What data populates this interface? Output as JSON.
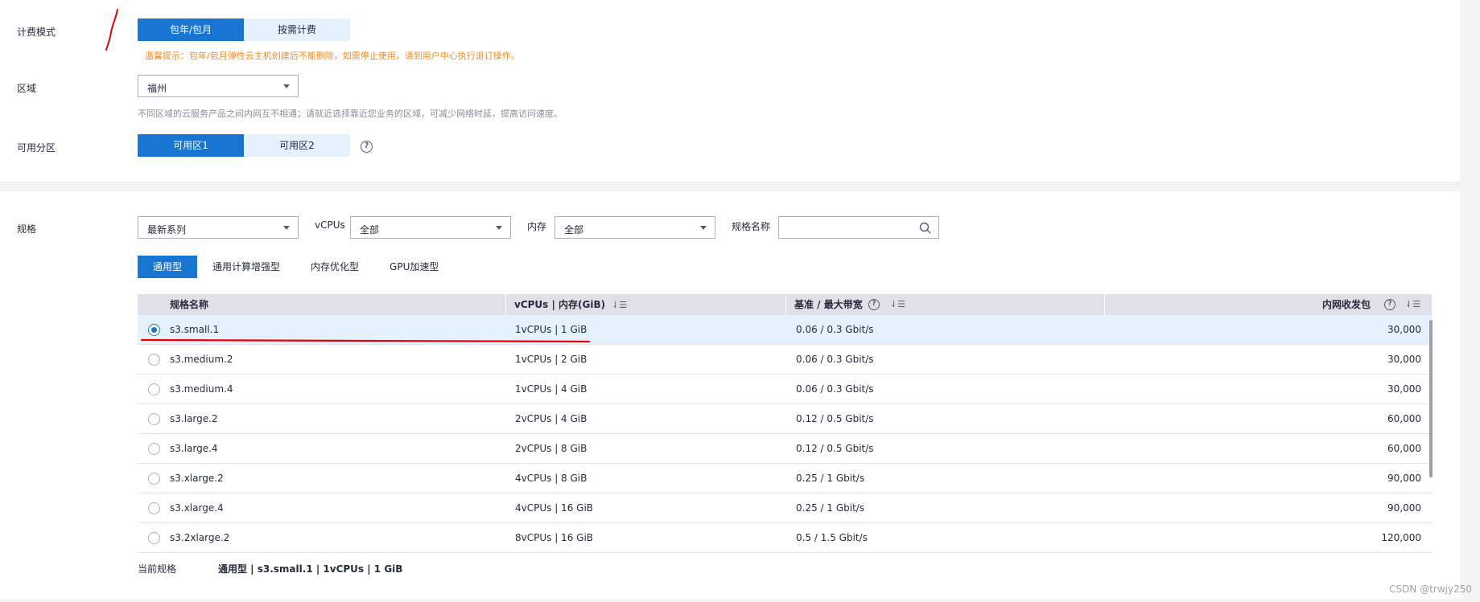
{
  "billing": {
    "label": "计费模式",
    "options": [
      "包年/包月",
      "按需计费"
    ],
    "selected_index": 0,
    "warning": "温馨提示：包年/包月弹性云主机创建后不能删除，如需停止使用，请到用户中心执行退订操作。"
  },
  "region": {
    "label": "区域",
    "value": "福州",
    "hint": "不同区域的云服务产品之间内网互不相通；请就近选择靠近您业务的区域，可减少网络时延，提高访问速度。"
  },
  "az": {
    "label": "可用分区",
    "options": [
      "可用区1",
      "可用区2"
    ],
    "selected_index": 0,
    "help": "?"
  },
  "spec": {
    "label": "规格",
    "filters": {
      "series_value": "最新系列",
      "vcpus_label": "vCPUs",
      "vcpus_value": "全部",
      "memory_label": "内存",
      "memory_value": "全部",
      "name_label": "规格名称",
      "name_value": ""
    },
    "tabs": [
      "通用型",
      "通用计算增强型",
      "内存优化型",
      "GPU加速型"
    ],
    "active_tab": 0,
    "columns": {
      "name": "规格名称",
      "vcpus_mem": "vCPUs | 内存(GiB)",
      "bandwidth": "基准 / 最大带宽",
      "pps": "内网收发包"
    },
    "rows": [
      {
        "name": "s3.small.1",
        "cpu_mem": "1vCPUs | 1 GiB",
        "bw": "0.06 / 0.3 Gbit/s",
        "pps": "30,000",
        "selected": true
      },
      {
        "name": "s3.medium.2",
        "cpu_mem": "1vCPUs | 2 GiB",
        "bw": "0.06 / 0.3 Gbit/s",
        "pps": "30,000",
        "selected": false
      },
      {
        "name": "s3.medium.4",
        "cpu_mem": "1vCPUs | 4 GiB",
        "bw": "0.06 / 0.3 Gbit/s",
        "pps": "30,000",
        "selected": false
      },
      {
        "name": "s3.large.2",
        "cpu_mem": "2vCPUs | 4 GiB",
        "bw": "0.12 / 0.5 Gbit/s",
        "pps": "60,000",
        "selected": false
      },
      {
        "name": "s3.large.4",
        "cpu_mem": "2vCPUs | 8 GiB",
        "bw": "0.12 / 0.5 Gbit/s",
        "pps": "60,000",
        "selected": false
      },
      {
        "name": "s3.xlarge.2",
        "cpu_mem": "4vCPUs | 8 GiB",
        "bw": "0.25 / 1 Gbit/s",
        "pps": "90,000",
        "selected": false
      },
      {
        "name": "s3.xlarge.4",
        "cpu_mem": "4vCPUs | 16 GiB",
        "bw": "0.25 / 1 Gbit/s",
        "pps": "90,000",
        "selected": false
      },
      {
        "name": "s3.2xlarge.2",
        "cpu_mem": "8vCPUs | 16 GiB",
        "bw": "0.5 / 1.5 Gbit/s",
        "pps": "120,000",
        "selected": false
      }
    ],
    "current_label": "当前规格",
    "current_value": "通用型 | s3.small.1 | 1vCPUs | 1 GiB"
  },
  "watermark": "CSDN @trwjy250",
  "colors": {
    "primary": "#1975d2",
    "light_primary": "#e5f1fd",
    "warning": "#f58a1f",
    "annotation": "#e3000b"
  }
}
